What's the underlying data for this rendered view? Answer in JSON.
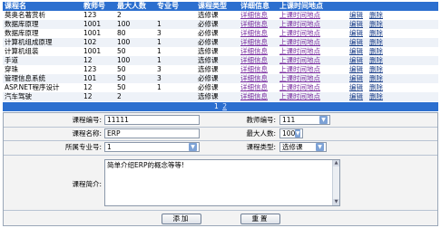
{
  "table": {
    "headers": [
      "课程名",
      "教师号",
      "最大人数",
      "专业号",
      "课程类型",
      "详细信息",
      "上课时间地点",
      "",
      ""
    ],
    "rows": [
      {
        "name": "莫奥名著赏析",
        "teacher": "123",
        "max": "2",
        "major": "",
        "type": "选修课",
        "detail": "详细信息",
        "time": "上课时间地点",
        "edit": "编辑",
        "del": "删除"
      },
      {
        "name": "数据库原理",
        "teacher": "1001",
        "max": "100",
        "major": "1",
        "type": "必修课",
        "detail": "详细信息",
        "time": "上课时间地点",
        "edit": "编辑",
        "del": "删除"
      },
      {
        "name": "数据库原理",
        "teacher": "1001",
        "max": "80",
        "major": "3",
        "type": "必修课",
        "detail": "详细信息",
        "time": "上课时间地点",
        "edit": "编辑",
        "del": "删除"
      },
      {
        "name": "计算机组成原理",
        "teacher": "102",
        "max": "100",
        "major": "1",
        "type": "必修课",
        "detail": "详细信息",
        "time": "上课时间地点",
        "edit": "编辑",
        "del": "删除"
      },
      {
        "name": "计算机组装",
        "teacher": "1001",
        "max": "50",
        "major": "1",
        "type": "选修课",
        "detail": "详细信息",
        "time": "上课时间地点",
        "edit": "编辑",
        "del": "删除"
      },
      {
        "name": "手道",
        "teacher": "12",
        "max": "100",
        "major": "1",
        "type": "选修课",
        "detail": "详细信息",
        "time": "上课时间地点",
        "edit": "编辑",
        "del": "删除"
      },
      {
        "name": "穿珠",
        "teacher": "123",
        "max": "50",
        "major": "3",
        "type": "选修课",
        "detail": "详细信息",
        "time": "上课时间地点",
        "edit": "编辑",
        "del": "删除"
      },
      {
        "name": "管理信息系统",
        "teacher": "101",
        "max": "50",
        "major": "3",
        "type": "必修课",
        "detail": "详细信息",
        "time": "上课时间地点",
        "edit": "编辑",
        "del": "删除"
      },
      {
        "name": "ASP.NET程序设计",
        "teacher": "12",
        "max": "50",
        "major": "1",
        "type": "必修课",
        "detail": "详细信息",
        "time": "上课时间地点",
        "edit": "编辑",
        "del": "删除"
      },
      {
        "name": "汽车驾驶",
        "teacher": "12",
        "max": "2",
        "major": "",
        "type": "选修课",
        "detail": "详细信息",
        "time": "上课时间地点",
        "edit": "编辑",
        "del": "删除"
      }
    ]
  },
  "pager": {
    "current": "1",
    "next": "2"
  },
  "form": {
    "course_id_label": "课程编号:",
    "course_id_value": "11111",
    "teacher_id_label": "教师编号:",
    "teacher_id_value": "111",
    "course_name_label": "课程名称:",
    "course_name_value": "ERP",
    "max_label": "最大人数:",
    "max_value": "100",
    "major_label": "所属专业号:",
    "major_value": "1",
    "type_label": "课程类型:",
    "type_value": "选修课",
    "intro_label": "课程简介:",
    "intro_value": "简单介绍ERP的概念等等!",
    "add_button": "添加",
    "reset_button": "重置"
  },
  "colors": {
    "header_bg": "#2c6fcf",
    "link": "#7a2ea0"
  }
}
